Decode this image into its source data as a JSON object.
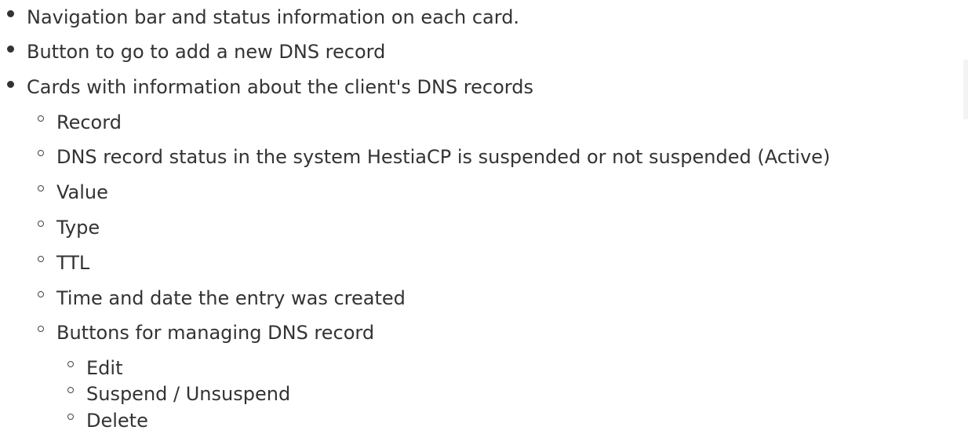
{
  "list": {
    "item1": "Navigation bar and status information on each card.",
    "item2": "Button to go to add a new DNS record",
    "item3": "Cards with information about the client's DNS records",
    "sub": {
      "record": "Record",
      "status": "DNS record status in the system HestiaCP is suspended or not suspended (Active)",
      "value": "Value",
      "type": "Type",
      "ttl": " TTL",
      "created": "Time and date the entry was created",
      "buttons": "Buttons for managing DNS record",
      "actions": {
        "edit": "Edit",
        "suspend": "Suspend / Unsuspend",
        "delete": "Delete"
      }
    }
  }
}
